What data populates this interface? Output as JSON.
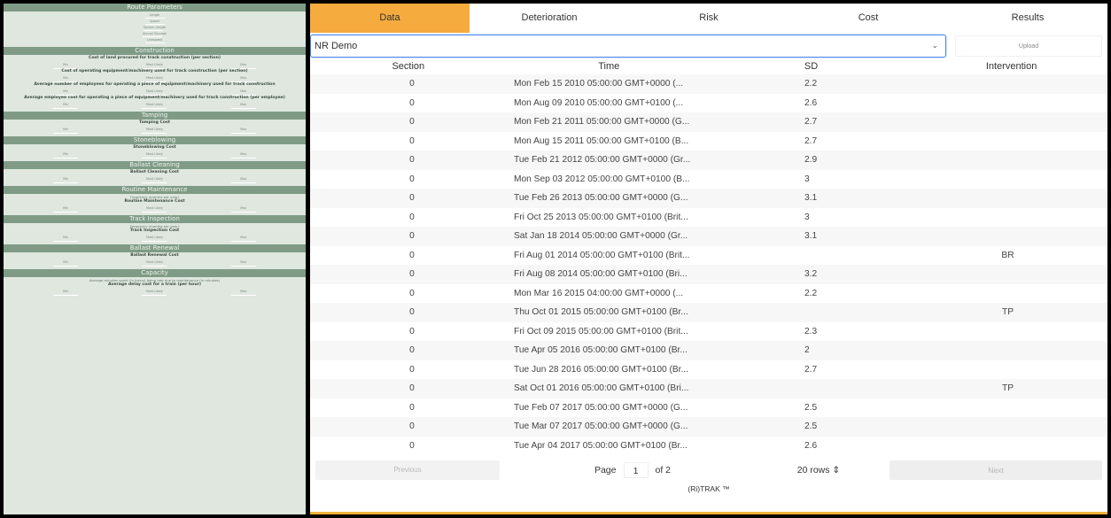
{
  "left_panel": {
    "sections": [
      {
        "title": "Route Parameters",
        "params": [],
        "solo_inputs": [
          "Length",
          "Speed",
          "Section Length",
          "Annual Tonnage",
          "Linespeed"
        ]
      },
      {
        "title": "Construction",
        "params": [
          {
            "title": "Cost of land procured for track construction (per section)",
            "inputs": [
              "Min",
              "Most Likely",
              "Max"
            ]
          },
          {
            "title": "Cost of operating equipment/machinery used for track construction (per section)",
            "inputs": [
              "Min",
              "Most Likely",
              "Max"
            ]
          },
          {
            "title": "Average number of employees for operating a piece of equipment/machinery used for track construction",
            "inputs": [
              "Min",
              "Most Likely",
              "Max"
            ]
          },
          {
            "title": "Average employee cost for operating a piece of equipment/machinery used for track construction (per employee)",
            "inputs": [
              "Min",
              "Most Likely",
              "Max"
            ]
          }
        ]
      },
      {
        "title": "Tamping",
        "params": [
          {
            "title": "Tamping Cost",
            "inputs": [
              "Min",
              "Most Likely",
              "Max"
            ]
          }
        ]
      },
      {
        "title": "Stoneblowing",
        "params": [
          {
            "title": "Stoneblowing Cost",
            "inputs": [
              "Min",
              "Most Likely",
              "Max"
            ]
          }
        ]
      },
      {
        "title": "Ballast Cleaning",
        "params": [
          {
            "title": "Ballast Cleaning Cost",
            "inputs": [
              "Min",
              "Most Likely",
              "Max"
            ]
          }
        ]
      },
      {
        "title": "Routine Maintenance",
        "note": "Frequency (months per year)",
        "params": [
          {
            "title": "Routine Maintenance Cost",
            "inputs": [
              "Min",
              "Most Likely",
              "Max"
            ]
          }
        ]
      },
      {
        "title": "Track Inspection",
        "note": "Frequency (months per year)",
        "params": [
          {
            "title": "Track Inspection Cost",
            "inputs": [
              "Min",
              "Most Likely",
              "Max"
            ]
          }
        ]
      },
      {
        "title": "Ballast Renewal",
        "params": [
          {
            "title": "Ballast Renewal Cost",
            "inputs": [
              "Min",
              "Most Likely",
              "Max"
            ]
          }
        ]
      },
      {
        "title": "Capacity",
        "note": "Average minutes spent (in trains) being late due to maintenance (in minutes)",
        "params": [
          {
            "title": "Average delay cost for a train (per hour)",
            "inputs": [
              "Min",
              "Most Likely",
              "Max"
            ]
          }
        ]
      }
    ]
  },
  "tabs": [
    "Data",
    "Deterioration",
    "Risk",
    "Cost",
    "Results"
  ],
  "active_tab": "Data",
  "dataset_select": {
    "value": "NR Demo"
  },
  "upload_label": "Upload",
  "table": {
    "headers": {
      "section": "Section",
      "time": "Time",
      "sd": "SD",
      "intervention": "Intervention"
    },
    "rows": [
      {
        "section": "0",
        "time": "Mon Feb 15 2010 05:00:00 GMT+0000 (...",
        "sd": "2.2",
        "intervention": ""
      },
      {
        "section": "0",
        "time": "Mon Aug 09 2010 05:00:00 GMT+0100 (...",
        "sd": "2.6",
        "intervention": ""
      },
      {
        "section": "0",
        "time": "Mon Feb 21 2011 05:00:00 GMT+0000 (G...",
        "sd": "2.7",
        "intervention": ""
      },
      {
        "section": "0",
        "time": "Mon Aug 15 2011 05:00:00 GMT+0100 (B...",
        "sd": "2.7",
        "intervention": ""
      },
      {
        "section": "0",
        "time": "Tue Feb 21 2012 05:00:00 GMT+0000 (Gr...",
        "sd": "2.9",
        "intervention": ""
      },
      {
        "section": "0",
        "time": "Mon Sep 03 2012 05:00:00 GMT+0100 (B...",
        "sd": "3",
        "intervention": ""
      },
      {
        "section": "0",
        "time": "Tue Feb 26 2013 05:00:00 GMT+0000 (G...",
        "sd": "3.1",
        "intervention": ""
      },
      {
        "section": "0",
        "time": "Fri Oct 25 2013 05:00:00 GMT+0100 (Brit...",
        "sd": "3",
        "intervention": ""
      },
      {
        "section": "0",
        "time": "Sat Jan 18 2014 05:00:00 GMT+0000 (Gr...",
        "sd": "3.1",
        "intervention": ""
      },
      {
        "section": "0",
        "time": "Fri Aug 01 2014 05:00:00 GMT+0100 (Brit...",
        "sd": "",
        "intervention": "BR"
      },
      {
        "section": "0",
        "time": "Fri Aug 08 2014 05:00:00 GMT+0100 (Bri...",
        "sd": "3.2",
        "intervention": ""
      },
      {
        "section": "0",
        "time": "Mon Mar 16 2015 04:00:00 GMT+0000 (...",
        "sd": "2.2",
        "intervention": ""
      },
      {
        "section": "0",
        "time": "Thu Oct 01 2015 05:00:00 GMT+0100 (Br...",
        "sd": "",
        "intervention": "TP"
      },
      {
        "section": "0",
        "time": "Fri Oct 09 2015 05:00:00 GMT+0100 (Brit...",
        "sd": "2.3",
        "intervention": ""
      },
      {
        "section": "0",
        "time": "Tue Apr 05 2016 05:00:00 GMT+0100 (Br...",
        "sd": "2",
        "intervention": ""
      },
      {
        "section": "0",
        "time": "Tue Jun 28 2016 05:00:00 GMT+0100 (Br...",
        "sd": "2.7",
        "intervention": ""
      },
      {
        "section": "0",
        "time": "Sat Oct 01 2016 05:00:00 GMT+0100 (Bri...",
        "sd": "",
        "intervention": "TP"
      },
      {
        "section": "0",
        "time": "Tue Feb 07 2017 05:00:00 GMT+0000 (G...",
        "sd": "2.5",
        "intervention": ""
      },
      {
        "section": "0",
        "time": "Tue Mar 07 2017 05:00:00 GMT+0000 (G...",
        "sd": "2.5",
        "intervention": ""
      },
      {
        "section": "0",
        "time": "Tue Apr 04 2017 05:00:00 GMT+0100 (Br...",
        "sd": "2.6",
        "intervention": ""
      }
    ]
  },
  "pager": {
    "previous_label": "Previous",
    "page_label": "Page",
    "page_value": "1",
    "of_label": "of 2",
    "rows_label": "20 rows ⇕",
    "next_label": "Next"
  },
  "footer": "(Ri)TRAK ™",
  "colors": {
    "active_tab": "#f6ab3f",
    "panel_bg": "#dfe7df",
    "section_header": "#7f9b86",
    "focus_border": "#4a86e8"
  }
}
